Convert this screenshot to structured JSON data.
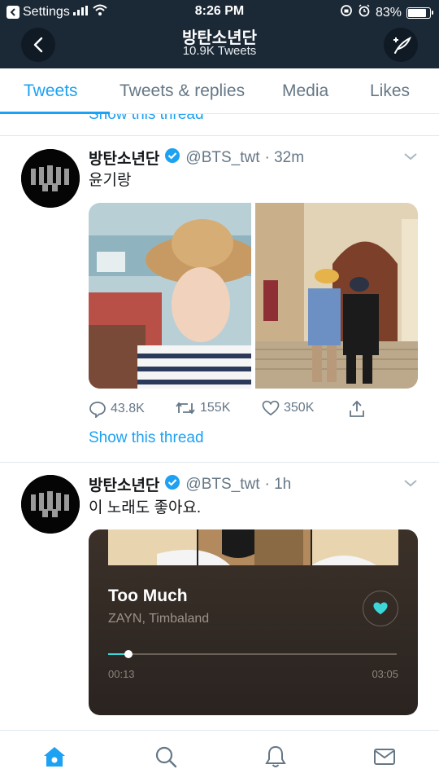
{
  "status": {
    "carrier": "Settings",
    "time": "8:26 PM",
    "battery": "83%",
    "battery_level": 0.83
  },
  "header": {
    "title": "방탄소년단",
    "subtitle": "10.9K Tweets"
  },
  "tabs": [
    {
      "label": "Tweets"
    },
    {
      "label": "Tweets & replies"
    },
    {
      "label": "Media"
    },
    {
      "label": "Likes"
    }
  ],
  "prev_thread_link": "Show this thread",
  "tweets": [
    {
      "name": "방탄소년단",
      "handle": "@BTS_twt",
      "time": "· 32m",
      "text": "윤기랑",
      "replies": "43.8K",
      "retweets": "155K",
      "likes": "350K",
      "show_thread": "Show this thread"
    },
    {
      "name": "방탄소년단",
      "handle": "@BTS_twt",
      "time": "· 1h",
      "text": "이 노래도 좋아요.",
      "music": {
        "title": "Too Much",
        "artist": "ZAYN, Timbaland",
        "elapsed": "00:13",
        "total": "03:05",
        "progress": 0.07
      }
    }
  ],
  "colors": {
    "accent": "#1da1f2",
    "header_bg": "#1b2836",
    "music_accent": "#3dd6d8"
  },
  "icons": {
    "nav": [
      "home-icon",
      "search-icon",
      "notifications-icon",
      "messages-icon"
    ]
  }
}
